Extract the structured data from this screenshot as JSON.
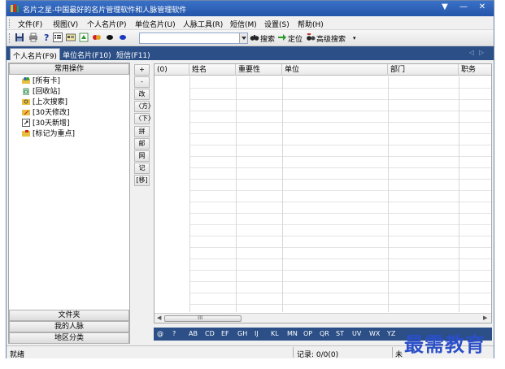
{
  "window": {
    "title": "名片之星-中国最好的名片管理软件和人脉管理软件",
    "controls": [
      "▼",
      "—",
      "✕"
    ]
  },
  "menu": {
    "items": [
      "文件(F)",
      "视图(V)",
      "个人名片(P)",
      "单位名片(U)",
      "人脉工具(R)",
      "短信(M)",
      "设置(S)",
      "帮助(H)"
    ]
  },
  "toolbar": {
    "icons": [
      "save-icon",
      "print-icon",
      "help-icon",
      "list-view-icon",
      "card-view-icon",
      "export-icon",
      "link-icon",
      "dot-black-icon",
      "dot-blue-icon"
    ],
    "search_value": "",
    "search_label": "搜索",
    "locate_label": "定位",
    "advanced_label": "高级搜索"
  },
  "tabs": [
    {
      "label": "个人名片(F9)",
      "active": true
    },
    {
      "label": "单位名片(F10)",
      "active": false
    },
    {
      "label": "短信(F11)",
      "active": false
    }
  ],
  "left_panel": {
    "header": "常用操作",
    "tree": [
      {
        "label": "[所有卡]",
        "icon": "folder-people-icon"
      },
      {
        "label": "[回收站]",
        "icon": "recycle-icon"
      },
      {
        "label": "[上次搜索]",
        "icon": "search-folder-icon"
      },
      {
        "label": "[30天修改]",
        "icon": "edit-folder-icon"
      },
      {
        "label": "[30天新增]",
        "icon": "new-folder-icon"
      },
      {
        "label": "[标记为重点]",
        "icon": "flag-folder-icon"
      }
    ],
    "bottom_sections": [
      "文件夹",
      "我的人脉",
      "地区分类"
    ]
  },
  "side_buttons": [
    "+",
    "-",
    "改",
    "〈方〉",
    "〈下〉",
    "拼",
    "邮",
    "网",
    "记",
    "[移]"
  ],
  "grid": {
    "count_label": "(0)",
    "columns": [
      "姓名",
      "重要性",
      "单位",
      "部门",
      "职务"
    ],
    "scroll_grip": "III"
  },
  "alphabet": [
    "@",
    "?",
    "AB",
    "CD",
    "EF",
    "GH",
    "IJ",
    "KL",
    "MN",
    "OP",
    "QR",
    "ST",
    "UV",
    "WX",
    "YZ"
  ],
  "status": {
    "left": "就绪",
    "records": "记录: 0/0(0)",
    "right": "未"
  },
  "watermark": "最需教育",
  "colors": {
    "titlebar": "#2a5db0",
    "tabstrip": "#2b4f86",
    "watermark": "#2b4fc7"
  }
}
